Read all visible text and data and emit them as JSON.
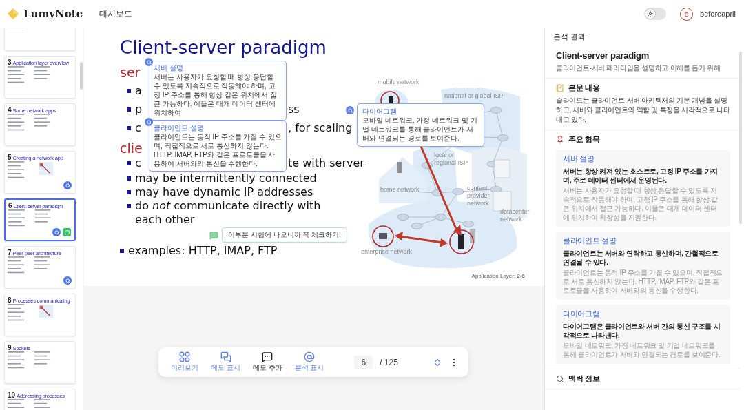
{
  "app": {
    "name": "LumyNote",
    "nav": [
      {
        "label": "대시보드"
      }
    ]
  },
  "theme_toggle": {
    "on": false
  },
  "user": {
    "initial": "b",
    "name": "beforeapril"
  },
  "thumbnails": [
    {
      "selected": false,
      "analyzed": false,
      "memo": false
    },
    {
      "number": "3",
      "title": "Application layer overview",
      "selected": false,
      "analyzed": false,
      "memo": false
    },
    {
      "number": "4",
      "title": "Some network apps",
      "selected": false,
      "analyzed": false,
      "memo": false
    },
    {
      "number": "5",
      "title": "Creating a network app",
      "selected": false,
      "analyzed": true,
      "memo": false
    },
    {
      "number": "6",
      "title": "Client-server paradigm",
      "selected": true,
      "analyzed": true,
      "memo": true
    },
    {
      "number": "7",
      "title": "Peer-peer architecture",
      "selected": false,
      "analyzed": true,
      "memo": false
    },
    {
      "number": "8",
      "title": "Processes communicating",
      "selected": false,
      "analyzed": false,
      "memo": false
    },
    {
      "number": "9",
      "title": "Sockets",
      "selected": false,
      "analyzed": false,
      "memo": false
    },
    {
      "number": "10",
      "title": "Addressing processes",
      "selected": false,
      "analyzed": false,
      "memo": false
    }
  ],
  "slide": {
    "title": "Client-server paradigm",
    "annotated_blocks": [
      {
        "popup": {
          "title": "서버 설명",
          "text": "서버는 사용자가 요청할 때 항상 응답할 수 있도록 지속적으로 작동해야 하며, 고정 IP 주소를 통해 항상 같은 위치에서 접근 가능하다. 이들은 대개 데이터 센터에 위치하여"
        },
        "rows": [
          {
            "kind": "heading",
            "left": "ser"
          },
          {
            "kind": "bullet",
            "left": "a"
          },
          {
            "kind": "bullet",
            "left": "p",
            "right": "ss"
          }
        ]
      },
      {
        "popup": {
          "title": "클라이언트 설명",
          "text": "클라이언트는 동적 IP 주소를 가질 수 있으며, 직접적으로 서로 통신하지 않는다. HTTP, IMAP, FTP와 같은 프로토콜을 사용하여 서버와의 통신을 수행한다."
        },
        "rows": [
          {
            "kind": "bullet",
            "left": "c",
            "right": ", for scaling"
          },
          {
            "kind": "heading",
            "left": "clie"
          },
          {
            "kind": "bullet",
            "left": "c",
            "right": "te with server"
          }
        ]
      }
    ],
    "lines": [
      {
        "kind": "bullet",
        "text": "may be intermittently connected"
      },
      {
        "kind": "bullet",
        "text": "may have dynamic IP addresses"
      },
      {
        "kind": "bullet",
        "text": "do *not* communicate directly with each other",
        "note": {
          "text": "이부분 시험에 나오니까 꼭 체크하기!"
        }
      },
      {
        "kind": "top",
        "text": "examples: HTTP, IMAP, FTP"
      }
    ],
    "diagram": {
      "labels": [
        "mobile network",
        "national or global ISP",
        "local or regional ISP",
        "home network",
        "content provider network",
        "datacenter network",
        "enterprise network"
      ],
      "popup": {
        "title": "다이어그램",
        "text": "모바일 네트워크, 가정 네트워크 및 기업 네트워크를 통해 클라이언트가 서버와 연결되는 경로를 보여준다."
      }
    },
    "footer": "Application Layer: 2-6"
  },
  "toolbar": {
    "buttons": [
      {
        "kind": "preview",
        "label": "미리보기",
        "active": true
      },
      {
        "kind": "show_memos",
        "label": "메모 표시",
        "active": true
      },
      {
        "kind": "add_memo",
        "label": "메모 추가",
        "active": false
      },
      {
        "kind": "show_analysis",
        "label": "분석 표시",
        "active": true
      }
    ],
    "page": "6",
    "total": "/ 125"
  },
  "analysis": {
    "heading": "분석 결과",
    "title": "Client-server paradigm",
    "subtitle": "클라이언트-서버 패러다임을 설명하고 이해를 돕기 위해",
    "sections": [
      {
        "kind": "body",
        "title": "본문 내용",
        "text": "슬라이드는 클라이언트-서버 아키텍처의 기본 개념을 설명하고, 서버와 클라이언트의 역할 및 특징을 시각적으로 나타내고 있다."
      },
      {
        "kind": "items",
        "title": "주요 항목",
        "items": [
          {
            "title": "서버 설명",
            "summary": "서버는 항상 켜져 있는 호스트로, 고정 IP 주소를 가지며, 주로 데이터 센터에서 운영된다.",
            "detail": "서버는 사용자가 요청할 때 항상 응답할 수 있도록 지속적으로 작동해야 하며, 고정 IP 주소를 통해 항상 같은 위치에서 접근 가능하다. 이들은 대개 데이터 센터에 위치하여 확장성을 지원한다."
          },
          {
            "title": "클라이언트 설명",
            "summary": "클라이언트는 서버와 연락하고 통신하며, 간헐적으로 연결될 수 있다.",
            "detail": "클라이언트는 동적 IP 주소를 가질 수 있으며, 직접적으로 서로 통신하지 않는다. HTTP, IMAP, FTP와 같은 프로토콜을 사용하여 서버와의 통신을 수행한다."
          },
          {
            "title": "다이어그램",
            "summary": "다이어그램은 클라이언트와 서버 간의 통신 구조를 시각적으로 나타낸다.",
            "detail": "모바일 네트워크, 가정 네트워크 및 기업 네트워크를 통해 클라이언트가 서버와 연결되는 경로를 보여준다."
          }
        ]
      },
      {
        "kind": "context",
        "title": "맥락 정보"
      }
    ]
  }
}
